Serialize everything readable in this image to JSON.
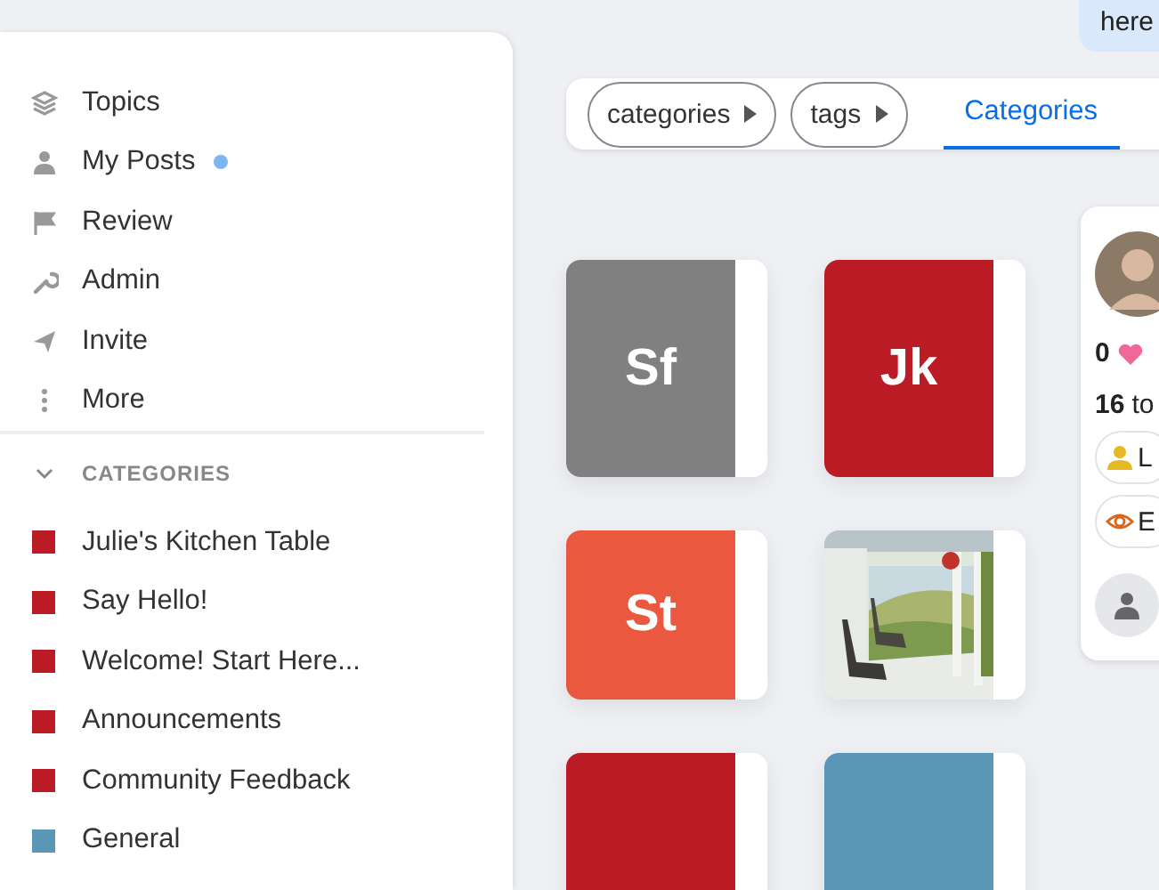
{
  "chat_bubble": {
    "text": "here"
  },
  "sidebar": {
    "nav": [
      {
        "label": "Topics",
        "unread": false
      },
      {
        "label": "My Posts",
        "unread": true
      },
      {
        "label": "Review",
        "unread": false
      },
      {
        "label": "Admin",
        "unread": false
      },
      {
        "label": "Invite",
        "unread": false
      },
      {
        "label": "More",
        "unread": false
      }
    ],
    "categories_header": {
      "label": "CATEGORIES",
      "expanded": true
    },
    "categories": [
      {
        "name": "Julie's Kitchen Table",
        "color": "#bb1b25"
      },
      {
        "name": "Say Hello!",
        "color": "#bb1b25"
      },
      {
        "name": "Welcome! Start Here...",
        "color": "#bb1b25"
      },
      {
        "name": "Announcements",
        "color": "#bb1b25"
      },
      {
        "name": "Community Feedback",
        "color": "#bb1b25"
      },
      {
        "name": "General",
        "color": "#5a97b6"
      }
    ]
  },
  "toolbar": {
    "breadcrumbs": [
      {
        "label": "categories"
      },
      {
        "label": "tags"
      }
    ],
    "tabs": [
      {
        "label": "Categories",
        "selected": true
      }
    ]
  },
  "tiles": [
    {
      "kind": "letters",
      "letters": "Sf",
      "color": "#808080"
    },
    {
      "kind": "letters",
      "letters": "Jk",
      "color": "#bb1b25"
    },
    {
      "kind": "letters",
      "letters": "St",
      "color": "#e9583f"
    },
    {
      "kind": "picture"
    },
    {
      "kind": "plain",
      "color": "#bb1b25"
    },
    {
      "kind": "plain",
      "color": "#5a97b6"
    }
  ],
  "user_card": {
    "likes": "0",
    "topics": "16 to",
    "badges": [
      {
        "label": "L",
        "kind": "person"
      },
      {
        "label": "E",
        "kind": "eye"
      }
    ]
  }
}
